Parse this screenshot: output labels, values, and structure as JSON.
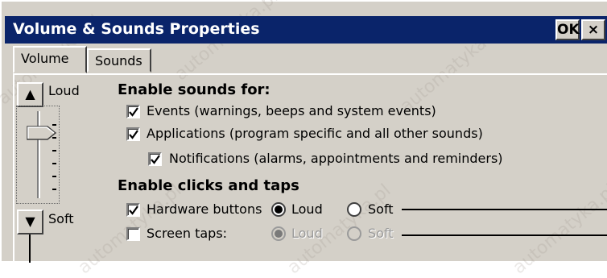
{
  "window": {
    "title": "Volume & Sounds Properties",
    "ok_label": "OK",
    "close_label": "×"
  },
  "tabs": [
    {
      "label": "Volume",
      "active": true
    },
    {
      "label": "Sounds",
      "active": false
    }
  ],
  "volume": {
    "up_button": "▲",
    "down_button": "▼",
    "loud_label": "Loud",
    "soft_label": "Soft",
    "level": 0.8
  },
  "enable_sounds": {
    "heading": "Enable sounds for:",
    "events": {
      "label": "Events (warnings, beeps and system events)",
      "checked": true
    },
    "applications": {
      "label": "Applications (program specific and all other sounds)",
      "checked": true
    },
    "notifications": {
      "label": "Notifications (alarms, appointments and reminders)",
      "checked": true
    }
  },
  "enable_clicks": {
    "heading": "Enable clicks and taps",
    "hardware": {
      "label": "Hardware buttons",
      "checked": true,
      "loud": "Loud",
      "soft": "Soft",
      "selected": "loud"
    },
    "screen": {
      "label": "Screen taps:",
      "checked": false,
      "loud": "Loud",
      "soft": "Soft",
      "selected": "loud",
      "disabled": true
    }
  },
  "watermark": "automatyka.pl",
  "colors": {
    "titlebar": "#0a246a",
    "face": "#d4d0c8"
  }
}
